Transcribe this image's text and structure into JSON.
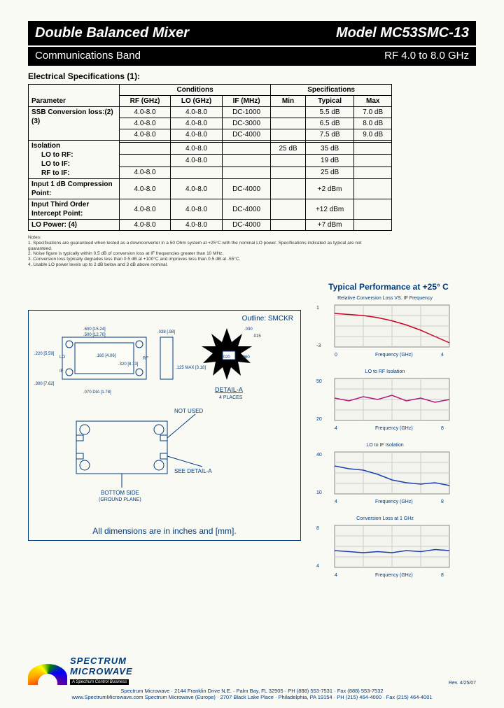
{
  "header": {
    "title": "Double Balanced Mixer",
    "model": "Model MC53SMC-13",
    "band": "Communications Band",
    "freq": "RF 4.0 to 8.0 GHz"
  },
  "spec_title": "Electrical Specifications (1):",
  "table": {
    "group_conditions": "Conditions",
    "group_specs": "Specifications",
    "cols": {
      "param": "Parameter",
      "rf": "RF (GHz)",
      "lo": "LO (GHz)",
      "if": "IF (MHz)",
      "min": "Min",
      "typ": "Typical",
      "max": "Max"
    },
    "rows": [
      {
        "param": "SSB Conversion loss:(2)(3)",
        "rf": "4.0-8.0",
        "lo": "4.0-8.0",
        "if": "DC-1000",
        "min": "",
        "typ": "5.5 dB",
        "max": "7.0 dB"
      },
      {
        "param": "",
        "rf": "4.0-8.0",
        "lo": "4.0-8.0",
        "if": "DC-3000",
        "min": "",
        "typ": "6.5 dB",
        "max": "8.0 dB"
      },
      {
        "param": "",
        "rf": "4.0-8.0",
        "lo": "4.0-8.0",
        "if": "DC-4000",
        "min": "",
        "typ": "7.5 dB",
        "max": "9.0 dB"
      },
      {
        "param": "Isolation",
        "rf": "",
        "lo": "",
        "if": "",
        "min": "",
        "typ": "",
        "max": ""
      },
      {
        "param": "LO to RF:",
        "rf": "",
        "lo": "4.0-8.0",
        "if": "",
        "min": "25 dB",
        "typ": "35 dB",
        "max": ""
      },
      {
        "param": "LO to IF:",
        "rf": "",
        "lo": "4.0-8.0",
        "if": "",
        "min": "",
        "typ": "19 dB",
        "max": ""
      },
      {
        "param": "RF to IF:",
        "rf": "4.0-8.0",
        "lo": "",
        "if": "",
        "min": "",
        "typ": "25 dB",
        "max": ""
      },
      {
        "param": "Input 1 dB Compression Point:",
        "rf": "4.0-8.0",
        "lo": "4.0-8.0",
        "if": "DC-4000",
        "min": "",
        "typ": "+2 dBm",
        "max": ""
      },
      {
        "param": "Input Third Order Intercept Point:",
        "rf": "4.0-8.0",
        "lo": "4.0-8.0",
        "if": "DC-4000",
        "min": "",
        "typ": "+12 dBm",
        "max": ""
      },
      {
        "param": "LO Power: (4)",
        "rf": "4.0-8.0",
        "lo": "4.0-8.0",
        "if": "DC-4000",
        "min": "",
        "typ": "+7 dBm",
        "max": ""
      }
    ]
  },
  "notes": {
    "heading": "Notes:",
    "items": [
      "1. Specifications are guaranteed when tested as a downconverter in a 50 Ohm system at +25°C with the nominal LO power. Specifications indicated as typical are not guaranteed.",
      "2. Noise figure is typically within 0.5 dB of conversion loss at IF frequencies greater than 10 MHz.",
      "3. Conversion loss typically degrades less than 0.5 dB at +100°C and improves less than 0.5 dB at -55°C.",
      "4. Usable LO power levels up to 2 dB below and 3 dB above nominal."
    ]
  },
  "outline": {
    "title": "Outline: SMCKR",
    "detail": "DETAIL-A",
    "places": "4 PLACES",
    "not_used": "NOT USED",
    "see_detail": "SEE DETAIL-A",
    "bottom_side": "BOTTOM SIDE",
    "ground_plane": "(GROUND PLANE)",
    "dims_note": "All dimensions are in inches and [mm].",
    "dims": {
      "w_overall": ".600 [15.24]",
      "w_body": ".500 [12.70]",
      "h_body": ".220 [5.59]",
      "h_overall": ".300 [7.62]",
      "pad_w": ".160 [4.06]",
      "pad_h": ".320 [8.13]",
      "hole": ".070 DIA [1.78]",
      "side_w": ".038 [.98]",
      "thick": ".125 MAX [3.18]",
      "det_a": ".030",
      "det_b": ".015",
      "det_c": ".020",
      "det_d": ".060"
    }
  },
  "charts_title": "Typical Performance at +25° C",
  "chart_data": [
    {
      "type": "line",
      "title": "Relative Conversion Loss VS. IF Frequency",
      "xlabel": "Frequency (GHz)",
      "xlim": [
        0,
        4.0
      ],
      "ylim": [
        -3,
        1
      ],
      "series": [
        {
          "name": "CL",
          "color": "#c02",
          "x": [
            0,
            0.5,
            1.0,
            1.5,
            2.0,
            2.5,
            3.0,
            3.5,
            4.0
          ],
          "values": [
            0.2,
            0.1,
            0.0,
            -0.2,
            -0.5,
            -0.9,
            -1.4,
            -2.0,
            -2.6
          ]
        }
      ]
    },
    {
      "type": "line",
      "title": "LO to RF Isolation",
      "xlabel": "Frequency (GHz)",
      "xlim": [
        4.0,
        8.0
      ],
      "ylim": [
        20,
        50
      ],
      "series": [
        {
          "name": "Iso",
          "color": "#b0187a",
          "x": [
            4.0,
            4.5,
            5.0,
            5.5,
            6.0,
            6.5,
            7.0,
            7.5,
            8.0
          ],
          "values": [
            36,
            34,
            37,
            35,
            38,
            34,
            36,
            33,
            35
          ]
        }
      ]
    },
    {
      "type": "line",
      "title": "LO to IF Isolation",
      "xlabel": "Frequency (GHz)",
      "xlim": [
        4.0,
        8.0
      ],
      "ylim": [
        10,
        40
      ],
      "series": [
        {
          "name": "Iso",
          "color": "#1a3fb0",
          "x": [
            4.0,
            4.5,
            5.0,
            5.5,
            6.0,
            6.5,
            7.0,
            7.5,
            8.0
          ],
          "values": [
            30,
            28,
            27,
            24,
            20,
            18,
            17,
            18,
            16
          ]
        }
      ]
    },
    {
      "type": "line",
      "title": "Conversion Loss at 1 GHz",
      "xlabel": "Frequency (GHz)",
      "xlim": [
        4.0,
        8.0
      ],
      "ylim": [
        4,
        8
      ],
      "series": [
        {
          "name": "CL",
          "color": "#1a3fb0",
          "x": [
            4.0,
            4.5,
            5.0,
            5.5,
            6.0,
            6.5,
            7.0,
            7.5,
            8.0
          ],
          "values": [
            5.6,
            5.5,
            5.4,
            5.5,
            5.4,
            5.6,
            5.5,
            5.7,
            5.6
          ]
        }
      ]
    }
  ],
  "footer": {
    "logo_top": "SPECTRUM",
    "logo_bottom": "MICROWAVE",
    "logo_tag": "A Spectrum Control Business",
    "line1": "Spectrum Microwave · 2144 Franklin Drive N.E. · Palm Bay, FL 32905 · PH (888) 553-7531 · Fax (888) 553-7532",
    "line2": "www.SpectrumMicrowave.com  Spectrum Microwave (Europe) · 2707 Black Lake Place · Philadelphia, PA 19154 · PH (215) 464-4000 · Fax (215) 464-4001",
    "rev": "Rev.\n4/25/07"
  }
}
